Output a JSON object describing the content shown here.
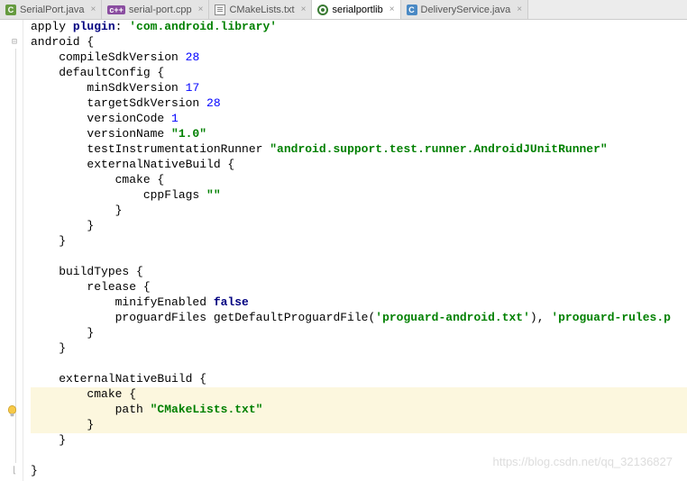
{
  "tabs": [
    {
      "label": "SerialPort.java"
    },
    {
      "label": "serial-port.cpp"
    },
    {
      "label": "CMakeLists.txt"
    },
    {
      "label": "serialportlib"
    },
    {
      "label": "DeliveryService.java"
    }
  ],
  "watermark": "https://blog.csdn.net/qq_32136827",
  "code": {
    "l1_a": "apply ",
    "l1_b": "plugin",
    "l1_c": ": ",
    "l1_d": "'com.android.library'",
    "l2": "android {",
    "l3_a": "    compileSdkVersion ",
    "l3_b": "28",
    "l4": "    defaultConfig {",
    "l5_a": "        minSdkVersion ",
    "l5_b": "17",
    "l6_a": "        targetSdkVersion ",
    "l6_b": "28",
    "l7_a": "        versionCode ",
    "l7_b": "1",
    "l8_a": "        versionName ",
    "l8_b": "\"1.0\"",
    "l9_a": "        testInstrumentationRunner ",
    "l9_b": "\"android.support.test.runner.AndroidJUnitRunner\"",
    "l10": "        externalNativeBuild {",
    "l11": "            cmake {",
    "l12_a": "                cppFlags ",
    "l12_b": "\"\"",
    "l13": "            }",
    "l14": "        }",
    "l15": "    }",
    "l16": "",
    "l17": "    buildTypes {",
    "l18": "        release {",
    "l19_a": "            minifyEnabled ",
    "l19_b": "false",
    "l20_a": "            proguardFiles getDefaultProguardFile(",
    "l20_b": "'proguard-android.txt'",
    "l20_c": "), ",
    "l20_d": "'proguard-rules.p",
    "l21": "        }",
    "l22": "    }",
    "l23": "",
    "l24": "    externalNativeBuild {",
    "l25": "        cmake {",
    "l26_a": "            path ",
    "l26_b": "\"CMakeLists.txt\"",
    "l27": "        }",
    "l28": "    }",
    "l29": "",
    "l30": "}"
  }
}
